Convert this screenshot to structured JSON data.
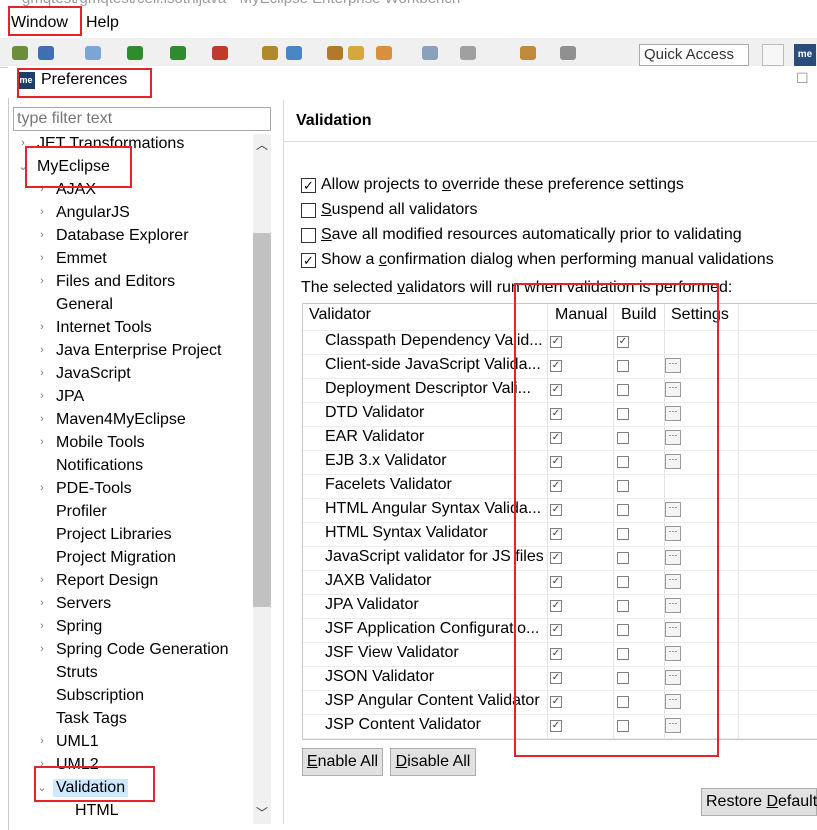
{
  "window_title": "gmqtest/gmqtest/cell.isothijava - MyEclipse Enterprise Workbench",
  "menubar": {
    "window": "Window",
    "help": "Help"
  },
  "toolbar": {
    "quick_access": "Quick Access",
    "perspective_icon": "me"
  },
  "dialog": {
    "icon_text": "me",
    "title": "Preferences",
    "close": "☐",
    "filter_placeholder": "type filter text"
  },
  "tree": {
    "items": [
      {
        "label": "JET Transformations",
        "arrow": "›",
        "indent": 0
      },
      {
        "label": "MyEclipse",
        "arrow": "⌄",
        "indent": 0
      },
      {
        "label": "AJAX",
        "arrow": "›",
        "indent": 1
      },
      {
        "label": "AngularJS",
        "arrow": "›",
        "indent": 1
      },
      {
        "label": "Database Explorer",
        "arrow": "›",
        "indent": 1
      },
      {
        "label": "Emmet",
        "arrow": "›",
        "indent": 1
      },
      {
        "label": "Files and Editors",
        "arrow": "›",
        "indent": 1
      },
      {
        "label": "General",
        "arrow": "",
        "indent": 1
      },
      {
        "label": "Internet Tools",
        "arrow": "›",
        "indent": 1
      },
      {
        "label": "Java Enterprise Project",
        "arrow": "›",
        "indent": 1
      },
      {
        "label": "JavaScript",
        "arrow": "›",
        "indent": 1
      },
      {
        "label": "JPA",
        "arrow": "›",
        "indent": 1
      },
      {
        "label": "Maven4MyEclipse",
        "arrow": "›",
        "indent": 1
      },
      {
        "label": "Mobile Tools",
        "arrow": "›",
        "indent": 1
      },
      {
        "label": "Notifications",
        "arrow": "",
        "indent": 1
      },
      {
        "label": "PDE-Tools",
        "arrow": "›",
        "indent": 1
      },
      {
        "label": "Profiler",
        "arrow": "",
        "indent": 1
      },
      {
        "label": "Project Libraries",
        "arrow": "",
        "indent": 1
      },
      {
        "label": "Project Migration",
        "arrow": "",
        "indent": 1
      },
      {
        "label": "Report Design",
        "arrow": "›",
        "indent": 1
      },
      {
        "label": "Servers",
        "arrow": "›",
        "indent": 1
      },
      {
        "label": "Spring",
        "arrow": "›",
        "indent": 1
      },
      {
        "label": "Spring Code Generation",
        "arrow": "›",
        "indent": 1
      },
      {
        "label": "Struts",
        "arrow": "",
        "indent": 1
      },
      {
        "label": "Subscription",
        "arrow": "",
        "indent": 1
      },
      {
        "label": "Task Tags",
        "arrow": "",
        "indent": 1
      },
      {
        "label": "UML1",
        "arrow": "›",
        "indent": 1
      },
      {
        "label": "UML2",
        "arrow": "›",
        "indent": 1
      },
      {
        "label": "Validation",
        "arrow": "⌄",
        "indent": 1,
        "selected": true
      },
      {
        "label": "HTML",
        "arrow": "",
        "indent": 2
      }
    ]
  },
  "page": {
    "title": "Validation",
    "options": [
      {
        "pre": "Allow projects to ",
        "u": "o",
        "post": "verride these preference settings",
        "checked": true
      },
      {
        "pre": "",
        "u": "S",
        "post": "uspend all validators",
        "checked": false
      },
      {
        "pre": "",
        "u": "S",
        "post": "ave all modified resources automatically prior to validating",
        "checked": false
      },
      {
        "pre": "Show a ",
        "u": "c",
        "post": "onfirmation dialog when performing manual validations",
        "checked": true
      }
    ],
    "caption": {
      "pre": "The selected ",
      "u": "v",
      "post": "alidators will run when validation is performed:"
    },
    "table": {
      "headers": {
        "validator": "Validator",
        "manual": "Manual",
        "build": "Build",
        "settings": "Settings"
      },
      "rows": [
        {
          "name": "Classpath Dependency Valid...",
          "manual": true,
          "build": true,
          "settings": false
        },
        {
          "name": "Client-side JavaScript Valida...",
          "manual": true,
          "build": false,
          "settings": true
        },
        {
          "name": "Deployment Descriptor Vali...",
          "manual": true,
          "build": false,
          "settings": true
        },
        {
          "name": "DTD Validator",
          "manual": true,
          "build": false,
          "settings": true
        },
        {
          "name": "EAR Validator",
          "manual": true,
          "build": false,
          "settings": true
        },
        {
          "name": "EJB 3.x Validator",
          "manual": true,
          "build": false,
          "settings": true
        },
        {
          "name": "Facelets Validator",
          "manual": true,
          "build": false,
          "settings": false
        },
        {
          "name": "HTML Angular Syntax Valida...",
          "manual": true,
          "build": false,
          "settings": true
        },
        {
          "name": "HTML Syntax Validator",
          "manual": true,
          "build": false,
          "settings": true
        },
        {
          "name": "JavaScript validator for JS files",
          "manual": true,
          "build": false,
          "settings": true
        },
        {
          "name": "JAXB Validator",
          "manual": true,
          "build": false,
          "settings": true
        },
        {
          "name": "JPA Validator",
          "manual": true,
          "build": false,
          "settings": true
        },
        {
          "name": "JSF Application Configuratio...",
          "manual": true,
          "build": false,
          "settings": true
        },
        {
          "name": "JSF View Validator",
          "manual": true,
          "build": false,
          "settings": true
        },
        {
          "name": "JSON Validator",
          "manual": true,
          "build": false,
          "settings": true
        },
        {
          "name": "JSP Angular Content Validator",
          "manual": true,
          "build": false,
          "settings": true
        },
        {
          "name": "JSP Content Validator",
          "manual": true,
          "build": false,
          "settings": true
        }
      ],
      "settings_glyph": "···"
    },
    "buttons": {
      "enable_all": {
        "u": "E",
        "post": "nable All"
      },
      "disable_all": {
        "u": "D",
        "post": "isable All"
      },
      "restore_defaults": {
        "pre": "Restore ",
        "u": "D",
        "post": "efaults"
      }
    }
  },
  "colors": {
    "annotation_red": "#e0262b",
    "selection": "#cde8ff",
    "scrollbar_thumb": "#c1c1c1"
  }
}
